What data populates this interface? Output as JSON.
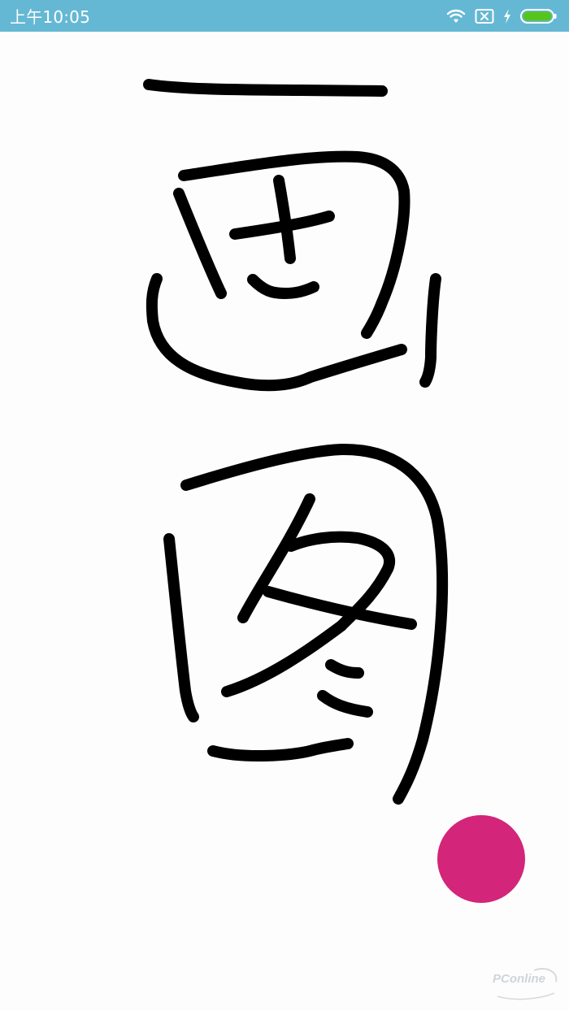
{
  "status_bar": {
    "time": "上午10:05",
    "background_color": "#65b8d3",
    "battery_color": "#55c51e",
    "icons": [
      "wifi-icon",
      "sim-no-signal-icon",
      "charging-bolt-icon",
      "battery-icon"
    ]
  },
  "canvas": {
    "background_color": "#fdfdfd",
    "stroke_color": "#000000"
  },
  "fab": {
    "color": "#d3257a"
  },
  "watermark": {
    "text": "PConline"
  }
}
